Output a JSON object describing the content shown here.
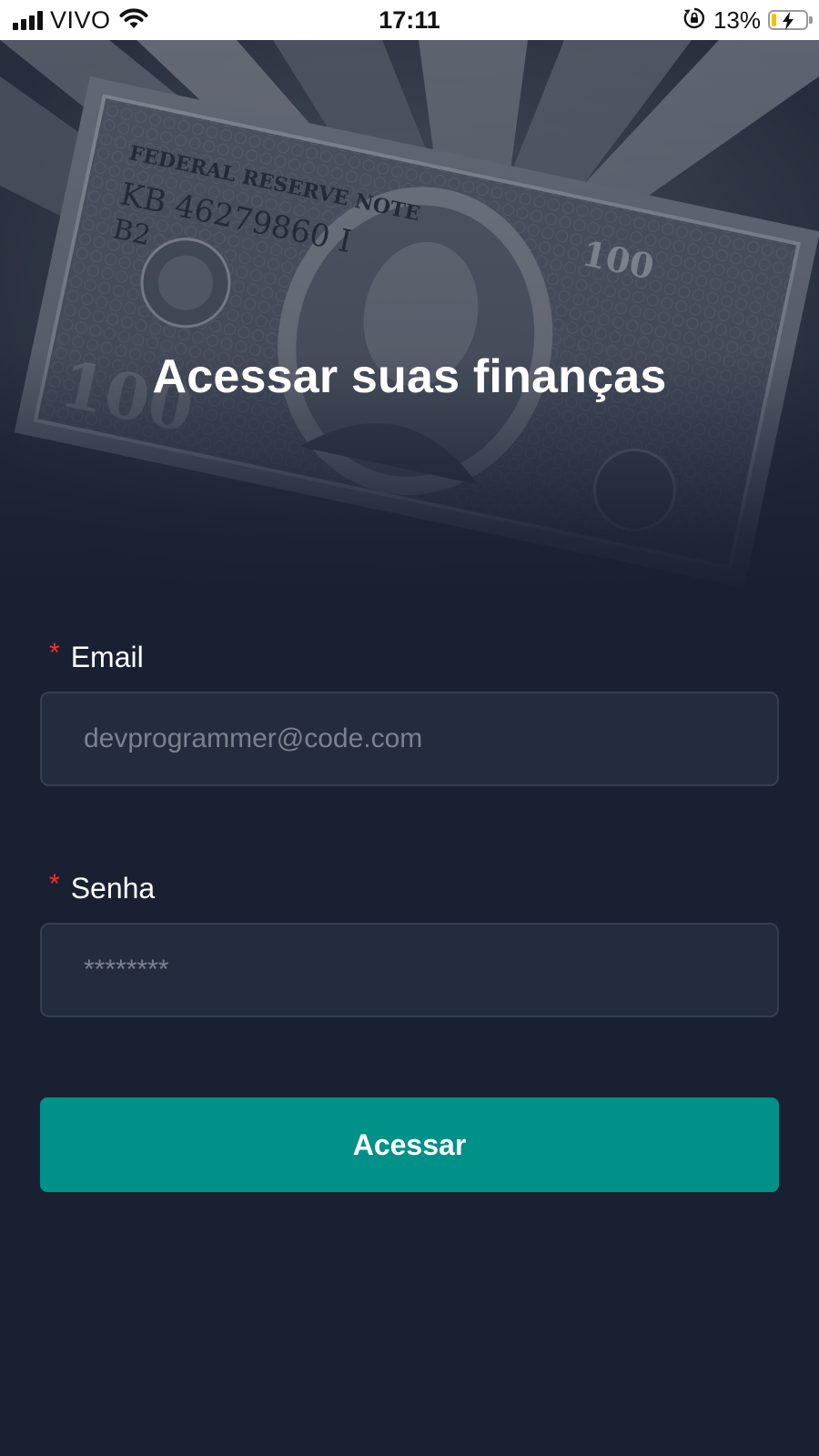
{
  "status_bar": {
    "carrier": "VIVO",
    "time": "17:11",
    "battery_percent": "13%",
    "battery_level": 0.13,
    "battery_color": "#f2c200",
    "icons": [
      "signal-bars-icon",
      "wifi-icon",
      "orientation-lock-icon",
      "battery-charging-icon"
    ]
  },
  "hero": {
    "title": "Acessar suas finanças",
    "background": "hundred-dollar-bills-photo",
    "photo_text": "FEDERAL RESERVE NOTE KB 46279860 I B2"
  },
  "form": {
    "required_mark": "*",
    "email": {
      "label": "Email",
      "placeholder": "devprogrammer@code.com",
      "value": ""
    },
    "password": {
      "label": "Senha",
      "placeholder": "********",
      "value": ""
    },
    "submit_label": "Acessar"
  },
  "colors": {
    "background": "#182032",
    "input_background": "#232c3f",
    "input_border": "#363f52",
    "accent": "#009189",
    "required": "#ff2b2b"
  }
}
